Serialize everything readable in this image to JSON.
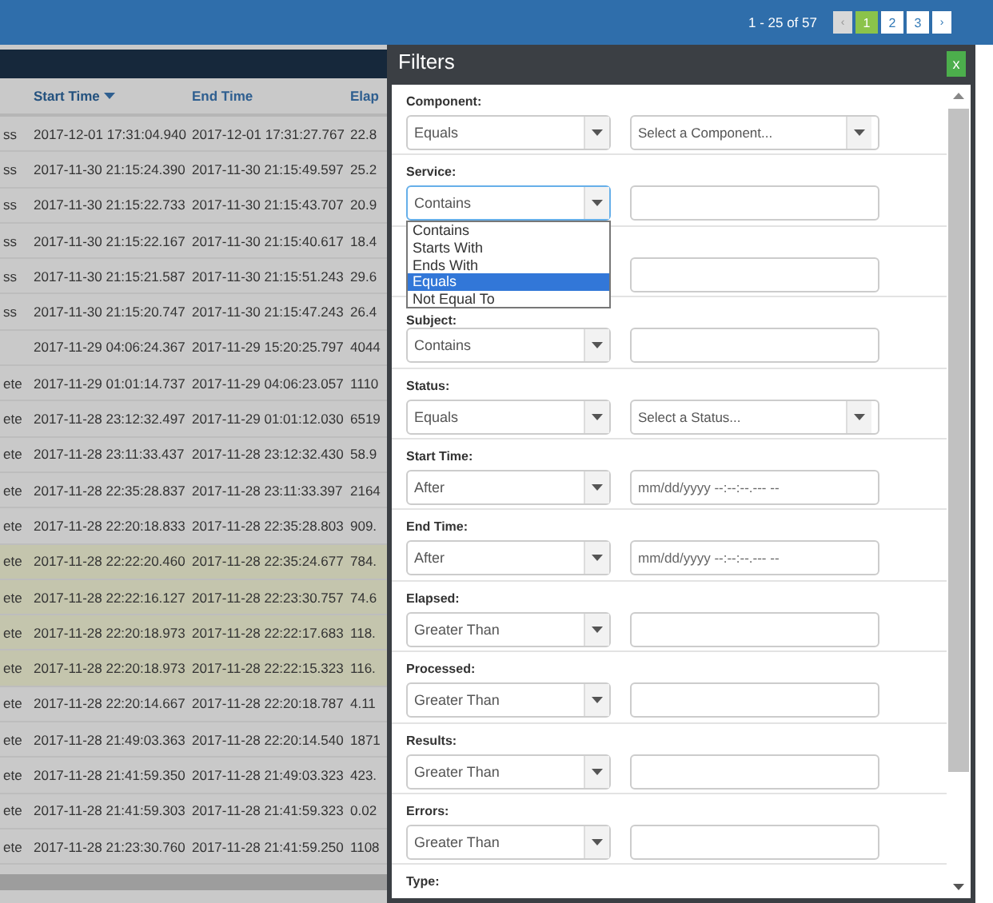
{
  "top_bar": {
    "summary": "1 - 25 of 57",
    "pages": [
      {
        "label": "‹",
        "kind": "arrow",
        "disabled": true
      },
      {
        "label": "1",
        "kind": "page",
        "selected": true
      },
      {
        "label": "2",
        "kind": "page",
        "selected": false
      },
      {
        "label": "3",
        "kind": "page",
        "selected": false
      },
      {
        "label": "›",
        "kind": "arrow",
        "disabled": false
      }
    ]
  },
  "table": {
    "columns": [
      {
        "label": "Start Time",
        "sorted": true
      },
      {
        "label": "End Time",
        "sorted": false
      },
      {
        "label": "Elap",
        "sorted": false
      }
    ],
    "rows": [
      {
        "column_1": "ss",
        "start_time": "2017-12-01 17:31:04.940",
        "end_time": "2017-12-01 17:31:27.767",
        "elapsed": "22.8",
        "highlighted": false
      },
      {
        "column_1": "ss",
        "start_time": "2017-11-30 21:15:24.390",
        "end_time": "2017-11-30 21:15:49.597",
        "elapsed": "25.2",
        "highlighted": false
      },
      {
        "column_1": "ss",
        "start_time": "2017-11-30 21:15:22.733",
        "end_time": "2017-11-30 21:15:43.707",
        "elapsed": "20.9",
        "highlighted": false
      },
      {
        "column_1": "ss",
        "start_time": "2017-11-30 21:15:22.167",
        "end_time": "2017-11-30 21:15:40.617",
        "elapsed": "18.4",
        "highlighted": false
      },
      {
        "column_1": "ss",
        "start_time": "2017-11-30 21:15:21.587",
        "end_time": "2017-11-30 21:15:51.243",
        "elapsed": "29.6",
        "highlighted": false
      },
      {
        "column_1": "ss",
        "start_time": "2017-11-30 21:15:20.747",
        "end_time": "2017-11-30 21:15:47.243",
        "elapsed": "26.4",
        "highlighted": false
      },
      {
        "start_time": "2017-11-29 04:06:24.367",
        "end_time": "2017-11-29 15:20:25.797",
        "elapsed": "4044",
        "highlighted": false
      },
      {
        "column_1": "ete",
        "start_time": "2017-11-29 01:01:14.737",
        "end_time": "2017-11-29 04:06:23.057",
        "elapsed": "1110",
        "highlighted": false
      },
      {
        "column_1": "ete",
        "start_time": "2017-11-28 23:12:32.497",
        "end_time": "2017-11-29 01:01:12.030",
        "elapsed": "6519",
        "highlighted": false
      },
      {
        "column_1": "ete",
        "start_time": "2017-11-28 23:11:33.437",
        "end_time": "2017-11-28 23:12:32.430",
        "elapsed": "58.9",
        "highlighted": false
      },
      {
        "column_1": "ete",
        "start_time": "2017-11-28 22:35:28.837",
        "end_time": "2017-11-28 23:11:33.397",
        "elapsed": "2164",
        "highlighted": false
      },
      {
        "column_1": "ete",
        "start_time": "2017-11-28 22:20:18.833",
        "end_time": "2017-11-28 22:35:28.803",
        "elapsed": "909.",
        "highlighted": false
      },
      {
        "column_1": "ete",
        "start_time": "2017-11-28 22:22:20.460",
        "end_time": "2017-11-28 22:35:24.677",
        "elapsed": "784.",
        "highlighted": true
      },
      {
        "column_1": "ete",
        "start_time": "2017-11-28 22:22:16.127",
        "end_time": "2017-11-28 22:23:30.757",
        "elapsed": "74.6",
        "highlighted": true
      },
      {
        "column_1": "ete",
        "start_time": "2017-11-28 22:20:18.973",
        "end_time": "2017-11-28 22:22:17.683",
        "elapsed": "118.",
        "highlighted": true
      },
      {
        "column_1": "ete",
        "start_time": "2017-11-28 22:20:18.973",
        "end_time": "2017-11-28 22:22:15.323",
        "elapsed": "116.",
        "highlighted": true
      },
      {
        "column_1": "ete",
        "start_time": "2017-11-28 22:20:14.667",
        "end_time": "2017-11-28 22:20:18.787",
        "elapsed": "4.11",
        "highlighted": false
      },
      {
        "column_1": "ete",
        "start_time": "2017-11-28 21:49:03.363",
        "end_time": "2017-11-28 22:20:14.540",
        "elapsed": "1871",
        "highlighted": false
      },
      {
        "column_1": "ete",
        "start_time": "2017-11-28 21:41:59.350",
        "end_time": "2017-11-28 21:49:03.323",
        "elapsed": "423.",
        "highlighted": false
      },
      {
        "column_1": "ete",
        "start_time": "2017-11-28 21:41:59.303",
        "end_time": "2017-11-28 21:41:59.323",
        "elapsed": "0.02",
        "highlighted": false
      },
      {
        "column_1": "ete",
        "start_time": "2017-11-28 21:23:30.760",
        "end_time": "2017-11-28 21:41:59.250",
        "elapsed": "1108",
        "highlighted": false
      }
    ]
  },
  "filters_panel": {
    "title": "Filters",
    "close_label": "x",
    "sections": [
      {
        "label": "Component:",
        "operator": "Equals",
        "kind": "select",
        "placeholder": "Select a Component..."
      },
      {
        "label": "Service:",
        "operator": "Contains",
        "kind": "text",
        "focused": true,
        "open_dropdown": {
          "options": [
            {
              "label": "Contains",
              "selected": false
            },
            {
              "label": "Starts With",
              "selected": false
            },
            {
              "label": "Ends With",
              "selected": false
            },
            {
              "label": "Equals",
              "selected": true
            },
            {
              "label": "Not Equal To",
              "selected": false
            }
          ]
        }
      },
      {
        "kind": "text"
      },
      {
        "label": "Subject:",
        "operator": "Contains",
        "kind": "text"
      },
      {
        "label": "Status:",
        "operator": "Equals",
        "kind": "select",
        "placeholder": "Select a Status..."
      },
      {
        "label": "Start Time:",
        "operator": "After",
        "kind": "date",
        "placeholder": "mm/dd/yyyy --:--:--.--- --"
      },
      {
        "label": "End Time:",
        "operator": "After",
        "kind": "date",
        "placeholder": "mm/dd/yyyy --:--:--.--- --"
      },
      {
        "label": "Elapsed:",
        "operator": "Greater Than",
        "kind": "text"
      },
      {
        "label": "Processed:",
        "operator": "Greater Than",
        "kind": "text"
      },
      {
        "label": "Results:",
        "operator": "Greater Than",
        "kind": "text"
      },
      {
        "label": "Errors:",
        "operator": "Greater Than",
        "kind": "text"
      },
      {
        "label": "Type:",
        "kind": "none"
      }
    ]
  }
}
